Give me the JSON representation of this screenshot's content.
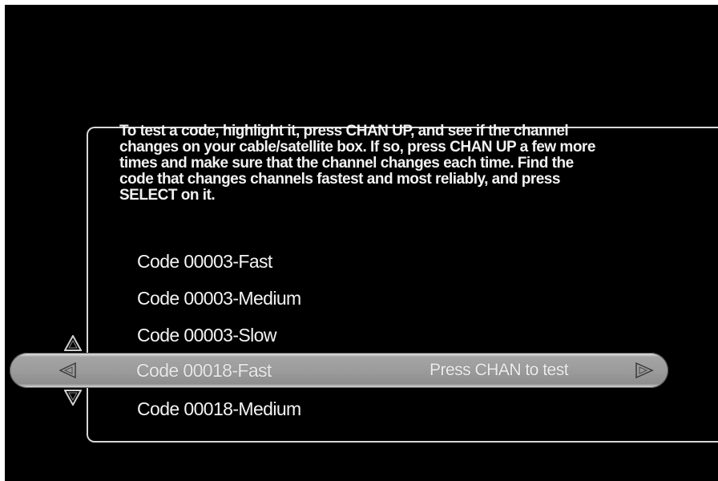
{
  "instructions": {
    "text": "To test a code, highlight it, press CHAN UP, and see if the channel\nchanges on your cable/satellite box.  If so, press CHAN UP a few more\ntimes and make sure that the channel changes each time.  Find the\ncode that changes channels fastest and most reliably, and press\nSELECT on it."
  },
  "codes": [
    {
      "label": "Code 00003-Fast"
    },
    {
      "label": "Code 00003-Medium"
    },
    {
      "label": "Code 00003-Slow"
    },
    {
      "label": "Code 00018-Fast",
      "selected": true,
      "hint": "Press CHAN to test"
    },
    {
      "label": "Code 00018-Medium"
    }
  ],
  "colors": {
    "background": "#000000",
    "text": "#f2f2f2",
    "highlight": "#9c9c9c",
    "frame": "#d8d8d8"
  },
  "icons": {
    "scroll_up": "triangle-up-outline",
    "scroll_down": "triangle-down-outline",
    "left": "triangle-left-outline",
    "right": "triangle-right-outline"
  }
}
